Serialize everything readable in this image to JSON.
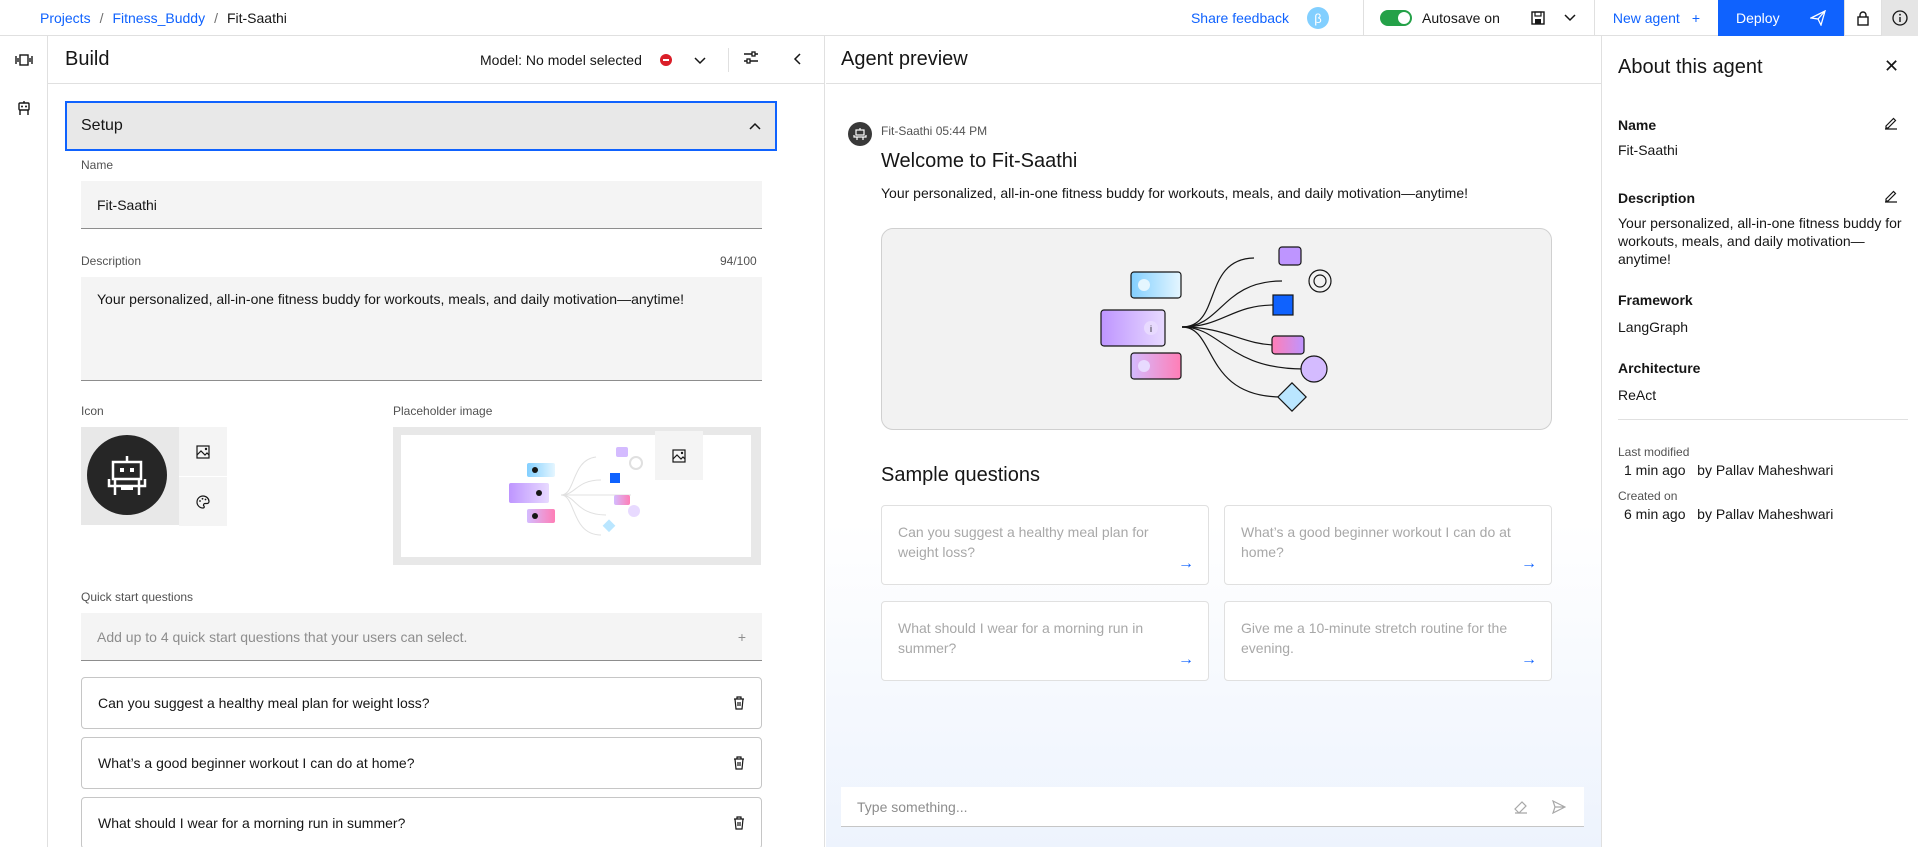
{
  "breadcrumb": {
    "items": [
      "Projects",
      "Fitness_Buddy"
    ],
    "current": "Fit-Saathi"
  },
  "topbar": {
    "share_feedback": "Share feedback",
    "beta": "β",
    "autosave": "Autosave on",
    "new_agent": "New agent",
    "new_agent_icon": "+",
    "deploy": "Deploy"
  },
  "build": {
    "title": "Build",
    "model_label": "Model: No model selected",
    "setup_title": "Setup",
    "name_label": "Name",
    "name_value": "Fit-Saathi",
    "description_label": "Description",
    "description_value": "Your personalized, all-in-one fitness buddy for workouts, meals, and daily motivation—anytime!",
    "description_counter": "94/100",
    "icon_label": "Icon",
    "placeholder_label": "Placeholder image",
    "quick_start_label": "Quick start questions",
    "quick_start_placeholder": "Add up to 4 quick start questions that your users can select.",
    "quick_start_add": "+",
    "questions": [
      "Can you suggest a healthy meal plan for weight loss?",
      "What’s a good beginner workout I can do at home?",
      "What should I wear for a morning run in summer?"
    ]
  },
  "preview": {
    "title": "Agent preview",
    "sender": "Fit-Saathi",
    "time": "05:44 PM",
    "welcome_title": "Welcome to Fit-Saathi",
    "welcome_desc": "Your personalized, all-in-one fitness buddy for workouts, meals, and daily motivation—anytime!",
    "sample_title": "Sample questions",
    "samples": [
      "Can you suggest a healthy meal plan for weight loss?",
      "What’s a good beginner workout I can do at home?",
      "What should I wear for a morning run in summer?",
      "Give me a 10-minute stretch routine for the evening."
    ],
    "chat_placeholder": "Type something..."
  },
  "about": {
    "title": "About this agent",
    "name_label": "Name",
    "name_value": "Fit-Saathi",
    "description_label": "Description",
    "description_value": "Your personalized, all-in-one fitness buddy for workouts, meals, and daily motivation—anytime!",
    "framework_label": "Framework",
    "framework_value": "LangGraph",
    "architecture_label": "Architecture",
    "architecture_value": "ReAct",
    "last_modified_label": "Last modified",
    "last_modified_value": "1 min ago",
    "last_modified_by": "by Pallav Maheshwari",
    "created_label": "Created on",
    "created_value": "6 min ago",
    "created_by": "by Pallav Maheshwari"
  },
  "colors": {
    "accent": "#0f62fe",
    "success": "#24a148",
    "danger": "#da1e28"
  }
}
